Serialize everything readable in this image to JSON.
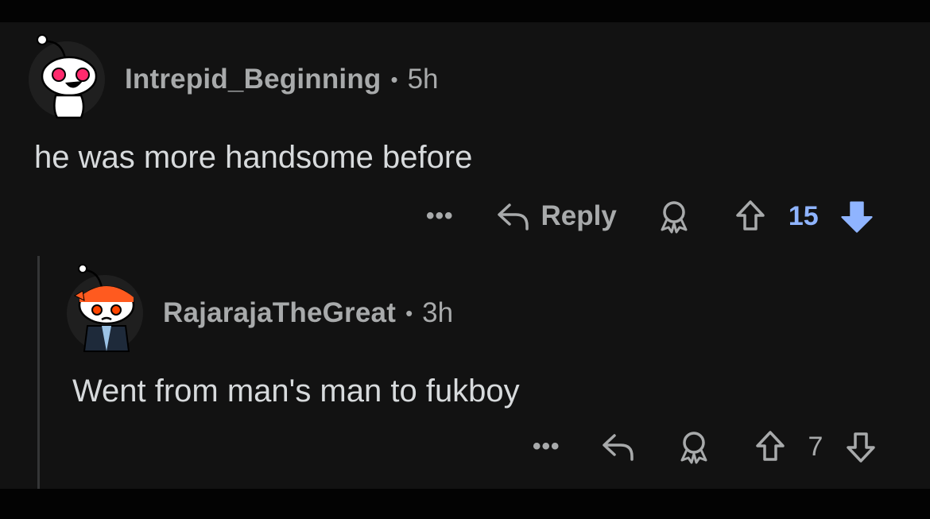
{
  "comments": [
    {
      "username": "Intrepid_Beginning",
      "separator": "•",
      "time": "5h",
      "body": "he was more handsome before",
      "more_label": "•••",
      "reply_label": "Reply",
      "score": "15",
      "vote_state": "downvoted",
      "accent_color": "#8fb4ff"
    },
    {
      "username": "RajarajaTheGreat",
      "separator": "•",
      "time": "3h",
      "body": "Went from man's man to fukboy",
      "more_label": "•••",
      "score": "7",
      "vote_state": "none"
    }
  ],
  "icons": [
    "snoo-avatar-icon",
    "reply-arrow-icon",
    "award-icon",
    "upvote-arrow-icon",
    "downvote-arrow-icon"
  ]
}
